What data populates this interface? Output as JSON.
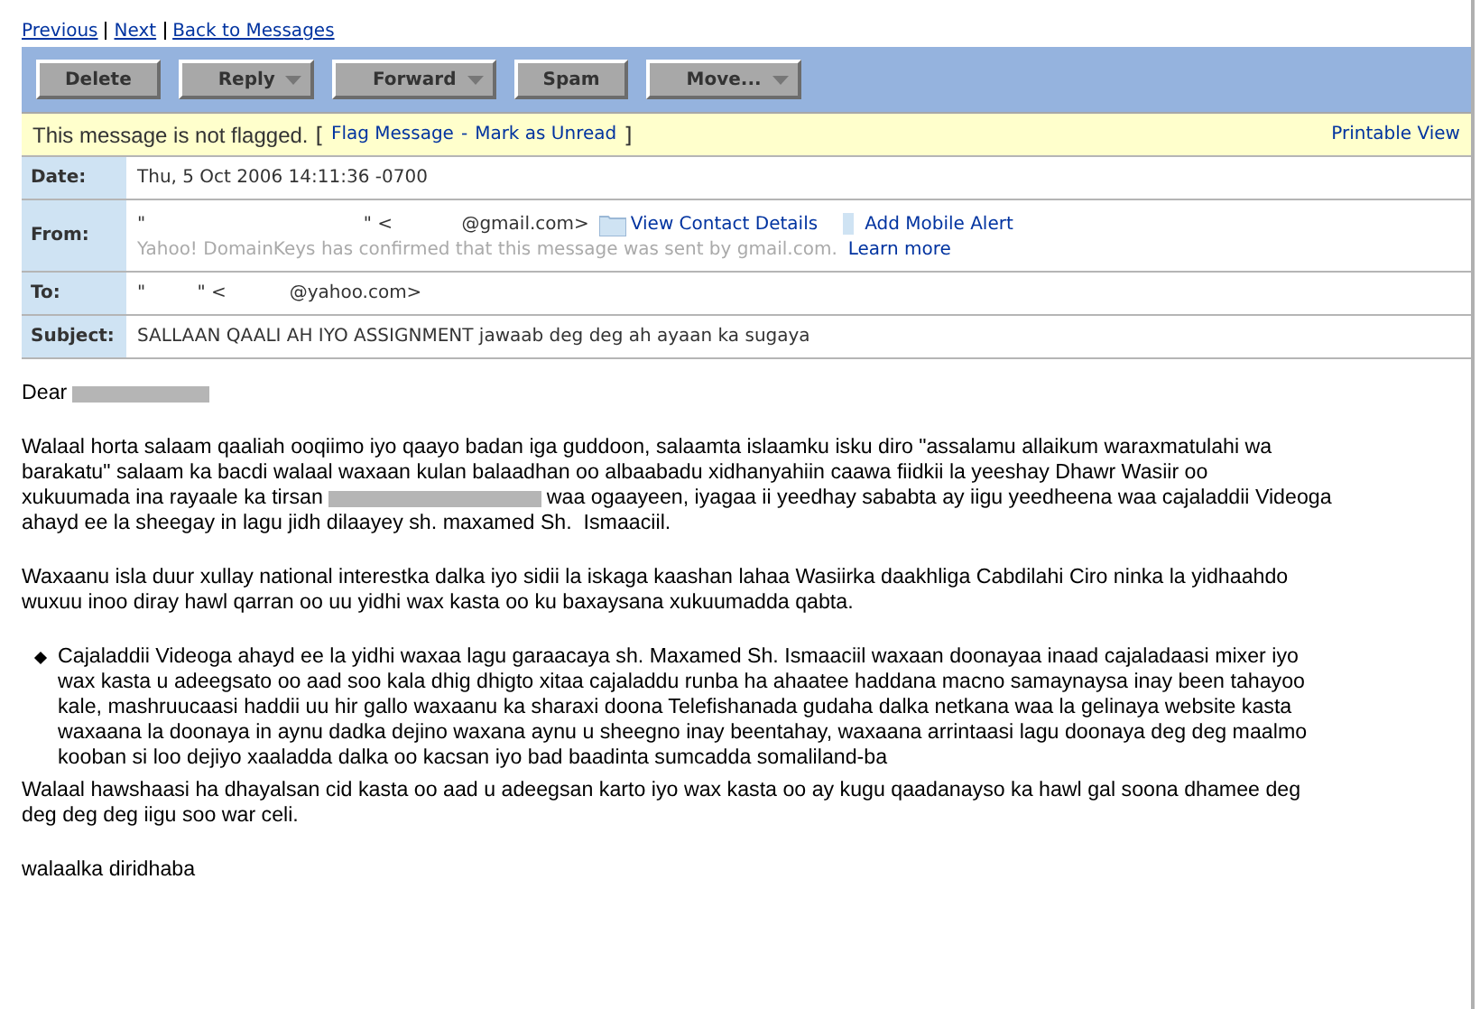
{
  "nav_links": [
    "Previous",
    "Next",
    "Back to Messages"
  ],
  "toolbar": [
    {
      "label": "Delete",
      "dropdown": false
    },
    {
      "label": "Reply",
      "dropdown": true
    },
    {
      "label": "Forward",
      "dropdown": true
    },
    {
      "label": "Spam",
      "dropdown": false
    },
    {
      "label": "Move...",
      "dropdown": true
    }
  ],
  "flag_bar": {
    "status": "This message is not flagged.",
    "open_bracket": "[",
    "actions": [
      "Flag Message",
      "Mark as Unread"
    ],
    "separator": "-",
    "close_bracket": "]",
    "printable": "Printable View"
  },
  "headers": {
    "date": {
      "label": "Date:",
      "value": "Thu, 5 Oct 2006 14:11:36 -0700"
    },
    "from": {
      "label": "From:",
      "value": "\"                                      \" <            @gmail.com>",
      "contact_link": "View Contact Details",
      "alert_link": "Add Mobile Alert",
      "note": "Yahoo! DomainKeys has confirmed that this message was sent by gmail.com.",
      "learn_more": "Learn more"
    },
    "to": {
      "label": "To:",
      "value": "\"         \" <           @yahoo.com>"
    },
    "subject": {
      "label": "Subject:",
      "value": "SALLAAN QAALI AH IYO ASSIGNMENT jawaab deg deg ah ayaan ka sugaya"
    }
  },
  "body": [
    {
      "kind": "greeting",
      "lines": [
        [
          {
            "kind": "text",
            "text": "Dear"
          },
          {
            "kind": "redacted"
          }
        ]
      ]
    },
    {
      "kind": "paragraph",
      "lines": [
        [
          {
            "kind": "text",
            "text": "Walaal horta salaam qaaliah ooqiimo iyo qaayo badan iga guddoon, salaamta islaamku isku diro \"assalamu allaikum waraxmatulahi wa"
          }
        ],
        [
          {
            "kind": "text",
            "text": "barakatu\" salaam ka bacdi walaal waxaan kulan balaadhan oo albaabadu xidhanyahiin caawa fiidkii la yeeshay Dhawr Wasiir oo"
          }
        ],
        [
          {
            "kind": "text",
            "text": "xukuumada ina rayaale ka tirsan"
          },
          {
            "kind": "redacted"
          },
          {
            "kind": "text",
            "text": "waa ogaayeen, iyagaa ii yeedhay sababta ay iigu yeedheena waa cajaladdii Videoga"
          }
        ],
        [
          {
            "kind": "text",
            "text": "ahayd ee la sheegay in lagu jidh dilaayey sh. maxamed Sh.  Ismaaciil."
          }
        ]
      ]
    },
    {
      "kind": "paragraph",
      "lines": [
        [
          {
            "kind": "text",
            "text": "Waxaanu isla duur xullay national interestka dalka iyo sidii la iskaga kaashan lahaa Wasiirka daakhliga Cabdilahi Ciro ninka la yidhaahdo"
          }
        ],
        [
          {
            "kind": "text",
            "text": "wuxuu inoo diray hawl qarran oo uu yidhi wax kasta oo ku baxaysana xukuumadda qabta."
          }
        ]
      ]
    },
    {
      "kind": "bullet",
      "lines": [
        [
          {
            "kind": "text",
            "text": "Cajaladdii Videoga ahayd ee la yidhi waxaa lagu garaacaya sh. Maxamed Sh. Ismaaciil waxaan doonayaa inaad cajaladaasi mixer iyo"
          }
        ],
        [
          {
            "kind": "text",
            "text": "wax kasta u adeegsato oo aad soo kala dhig dhigto xitaa cajaladdu runba ha ahaatee haddana macno samaynaysa inay been tahayoo"
          }
        ],
        [
          {
            "kind": "text",
            "text": "kale, mashruucaasi haddii uu hir gallo waxaanu ka sharaxi doona Telefishanada gudaha dalka netkana waa la gelinaya website kasta"
          }
        ],
        [
          {
            "kind": "text",
            "text": "waxaana la doonaya in aynu dadka dejino waxana aynu u sheegno inay beentahay, waxaana arrintaasi lagu doonaya deg deg maalmo"
          }
        ],
        [
          {
            "kind": "text",
            "text": "kooban si loo dejiyo xaaladda dalka oo kacsan iyo bad baadinta sumcadda somaliland-ba"
          }
        ]
      ]
    },
    {
      "kind": "tight",
      "lines": [
        [
          {
            "kind": "text",
            "text": "Walaal hawshaasi ha dhayalsan cid kasta oo aad u adeegsan karto iyo wax kasta oo ay kugu qaadanayso ka hawl gal soona dhamee deg"
          }
        ],
        [
          {
            "kind": "text",
            "text": "deg deg deg iigu soo war celi."
          }
        ]
      ]
    },
    {
      "kind": "paragraph",
      "lines": [
        [
          {
            "kind": "text",
            "text": "walaalka diridhaba"
          }
        ]
      ]
    }
  ]
}
